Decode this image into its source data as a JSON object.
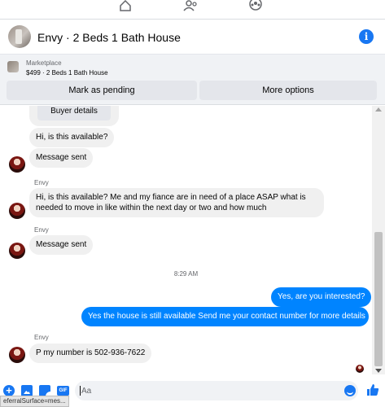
{
  "nav": {
    "icons": [
      "home-icon",
      "friends-icon",
      "groups-icon"
    ]
  },
  "conversation": {
    "title": "Envy · 2 Beds 1 Bath House"
  },
  "marketplace": {
    "label": "Marketplace",
    "listing": "$499 · 2 Beds 1 Bath House",
    "buttons": {
      "pending": "Mark as pending",
      "more": "More options"
    }
  },
  "messages": {
    "buyer_details": "Buyer details",
    "m1": "Hi, is this available?",
    "m2": "Message sent",
    "sender": "Envy",
    "m3": "Hi, is this available? Me and my fiance are in need of a place ASAP what is needed to move in like within the next day or two and how much",
    "m4": "Message sent",
    "time": "8:29 AM",
    "m5": "Yes, are you interested?",
    "m6": "Yes the house is still available Send me your contact number for more details",
    "m7": "P my number is 502-936-7622"
  },
  "composer": {
    "placeholder": "Aa",
    "gif_label": "GIF",
    "plus_label": "+"
  },
  "status_bar": {
    "text": "eferralSurface=mes..."
  },
  "colors": {
    "accent": "#1877f2",
    "outgoing": "#0084ff",
    "incoming": "#f0f0f0"
  }
}
